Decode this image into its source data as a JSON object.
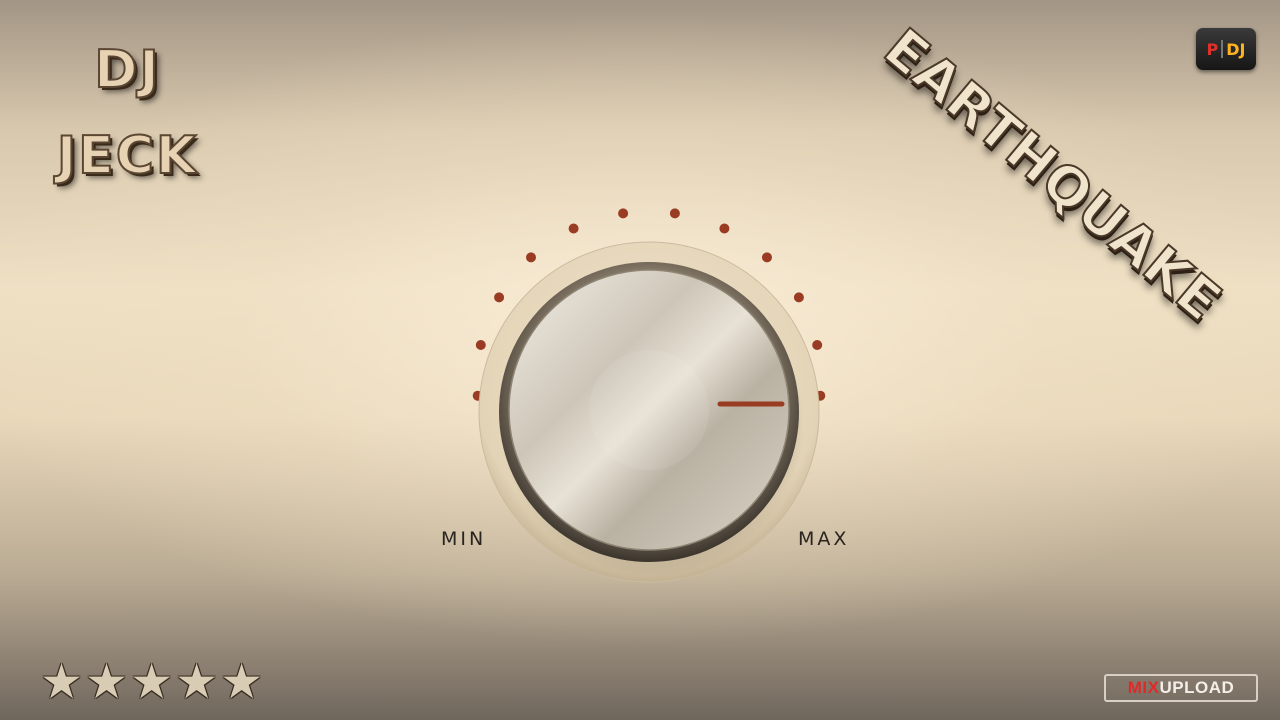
{
  "artist": {
    "line1": "DJ",
    "line2": "JECK"
  },
  "track_title": "EARTHQUAKE",
  "badge": {
    "p": "P",
    "dj": "DJ"
  },
  "knob": {
    "min_label": "MIN",
    "max_label": "MAX",
    "level": 0.875,
    "ticks_total": 16,
    "ticks_lit": 14
  },
  "rating": {
    "stars": 5,
    "max": 5,
    "glyph": "★"
  },
  "logo": {
    "mix": "MIX",
    "upload": "UPLOAD"
  },
  "colors": {
    "tick_active": "#9a3c24",
    "tick_inactive": "#2e2a26",
    "indicator": "#9a3c24",
    "badge_p": "#e0302a",
    "badge_dj": "#ffb21e",
    "logo_mix": "#e02a2a"
  }
}
